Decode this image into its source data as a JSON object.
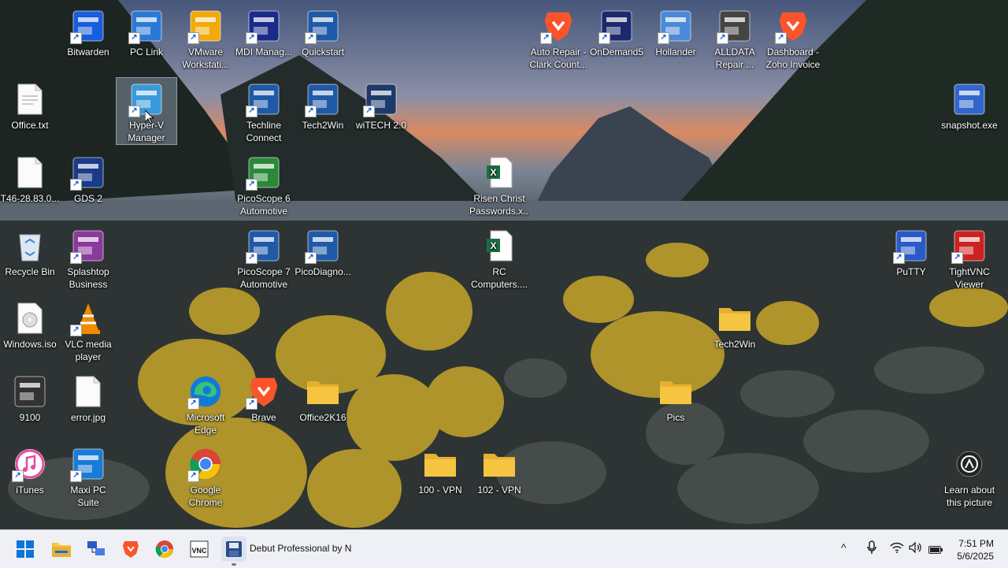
{
  "desktop": {
    "icons": [
      {
        "label": "Bitwarden",
        "icon": "bitwarden-icon",
        "color": "#175ddc"
      },
      {
        "label": "PC Link",
        "icon": "pc-link-icon",
        "color": "#2a7ad5"
      },
      {
        "label": "VMware Workstati...",
        "icon": "vmware-icon",
        "color": "#f2a90a"
      },
      {
        "label": "MDI Manag...",
        "icon": "mdi-manager-icon",
        "color": "#1a2a8a"
      },
      {
        "label": "Quickstart",
        "icon": "tech2win-icon",
        "color": "#1e5aa8"
      },
      {
        "label": "Auto Repair - Clark Count...",
        "icon": "brave-icon",
        "color": "#fb542b"
      },
      {
        "label": "OnDemand5",
        "icon": "ondemand5-icon",
        "color": "#1b2a6b"
      },
      {
        "label": "Hollander",
        "icon": "computer-icon",
        "color": "#4a8ad8"
      },
      {
        "label": "ALLDATA Repair ...",
        "icon": "alldata-icon",
        "color": "#444444"
      },
      {
        "label": "Dashboard - Zoho Invoice",
        "icon": "brave-icon",
        "color": "#fb542b"
      },
      {
        "label": "Office.txt",
        "icon": "text-file-icon",
        "color": "#ffffff"
      },
      {
        "label": "Hyper-V Manager",
        "icon": "hyperv-icon",
        "color": "#3a9ad9"
      },
      {
        "label": "Techline Connect",
        "icon": "techline-icon",
        "color": "#1e5aa8"
      },
      {
        "label": "Tech2Win",
        "icon": "tech2win-icon",
        "color": "#1e5aa8"
      },
      {
        "label": "wiTECH 2.0",
        "icon": "witech-icon",
        "color": "#1e3a6a"
      },
      {
        "label": "snapshot.exe",
        "icon": "camera-icon",
        "color": "#3366cc"
      },
      {
        "label": "T46-28.83.0...",
        "icon": "file-icon",
        "color": "#ffffff"
      },
      {
        "label": "GDS 2",
        "icon": "gds2-icon",
        "color": "#1a3a8a"
      },
      {
        "label": "PicoScope 6 Automotive",
        "icon": "picoscope-icon",
        "color": "#2a8a3a"
      },
      {
        "label": "Risen Christ Passwords.x...",
        "icon": "excel-icon",
        "color": "#1d6f42"
      },
      {
        "label": "Recycle Bin",
        "icon": "recycle-bin-icon",
        "color": "#9ab"
      },
      {
        "label": "Splashtop Business",
        "icon": "splashtop-icon",
        "color": "#8a3a9a"
      },
      {
        "label": "PicoScope 7 Automotive",
        "icon": "picoscope7-icon",
        "color": "#1e5aa8"
      },
      {
        "label": "PicoDiagno...",
        "icon": "picodiag-icon",
        "color": "#1e5aa8"
      },
      {
        "label": "RC Computers....",
        "icon": "excel-icon",
        "color": "#1d6f42"
      },
      {
        "label": "PuTTY",
        "icon": "putty-icon",
        "color": "#2a5ac8"
      },
      {
        "label": "TightVNC Viewer",
        "icon": "tightvnc-icon",
        "color": "#cc2222"
      },
      {
        "label": "Windows.iso",
        "icon": "disc-icon",
        "color": "#dddddd"
      },
      {
        "label": "VLC media player",
        "icon": "vlc-icon",
        "color": "#f28a00"
      },
      {
        "label": "Tech2Win",
        "icon": "folder-icon",
        "color": "#f5c542"
      },
      {
        "label": "9100",
        "icon": "printer-icon",
        "color": "#333333"
      },
      {
        "label": "error.jpg",
        "icon": "image-file-icon",
        "color": "#ffffff"
      },
      {
        "label": "Microsoft Edge",
        "icon": "edge-icon",
        "color": "#0f7ad8"
      },
      {
        "label": "Brave",
        "icon": "brave-icon",
        "color": "#fb542b"
      },
      {
        "label": "Office2K16",
        "icon": "folder-icon",
        "color": "#f5c542"
      },
      {
        "label": "Pics",
        "icon": "folder-icon",
        "color": "#f5c542"
      },
      {
        "label": "iTunes",
        "icon": "itunes-icon",
        "color": "#e84aa0"
      },
      {
        "label": "Maxi PC Suite",
        "icon": "maxi-icon",
        "color": "#1a7ad8"
      },
      {
        "label": "Google Chrome",
        "icon": "chrome-icon",
        "color": "#4285f4"
      },
      {
        "label": "100 - VPN",
        "icon": "folder-icon",
        "color": "#f5c542"
      },
      {
        "label": "102 - VPN",
        "icon": "folder-icon",
        "color": "#f5c542"
      },
      {
        "label": "Learn about this picture",
        "icon": "learn-picture-icon",
        "color": "#222222"
      }
    ]
  },
  "taskbar": {
    "items": [
      {
        "name": "start-icon",
        "color": "#0a74da"
      },
      {
        "name": "file-explorer-icon",
        "color": "#f5c542"
      },
      {
        "name": "network-app-icon",
        "color": "#2a5ac8"
      },
      {
        "name": "brave-icon",
        "color": "#fb542b"
      },
      {
        "name": "chrome-icon",
        "color": "#4285f4"
      },
      {
        "name": "tightvnc-icon",
        "color": "#cc2222"
      },
      {
        "name": "debut-icon",
        "color": "#2a4a8a"
      }
    ],
    "active_window_title": "Debut Professional by N",
    "tray": {
      "chevron": "^",
      "time": "7:51 PM",
      "date": "5/6/2025"
    }
  }
}
